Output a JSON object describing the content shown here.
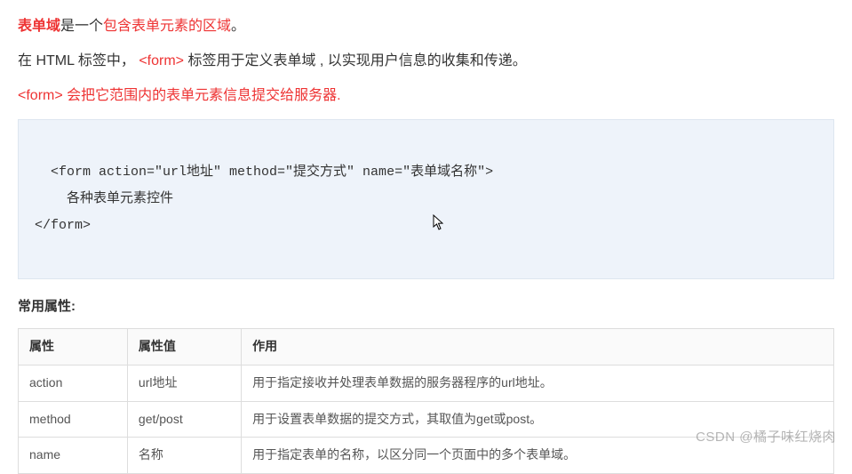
{
  "paragraphs": {
    "p1": {
      "s1": "表单域",
      "s2": "是一个",
      "s3": "包含表单元素的区域",
      "s4": "。"
    },
    "p2": {
      "s1": "在 HTML 标签中， ",
      "s2": "<form>",
      "s3": " 标签用于定义表单域 , 以实现用户信息的收集和传递。"
    },
    "p3": {
      "s1": "<form> 会把它范围内的表单元素信息提交给服务器."
    }
  },
  "code_block": "<form action=\"url地址\" method=\"提交方式\" name=\"表单域名称\">\n    各种表单元素控件\n</form>",
  "section_heading": "常用属性:",
  "table": {
    "headers": [
      "属性",
      "属性值",
      "作用"
    ],
    "rows": [
      {
        "attr": "action",
        "value": "url地址",
        "desc": "用于指定接收并处理表单数据的服务器程序的url地址。"
      },
      {
        "attr": "method",
        "value": "get/post",
        "desc": "用于设置表单数据的提交方式，其取值为get或post。"
      },
      {
        "attr": "name",
        "value": "名称",
        "desc": "用于指定表单的名称，以区分同一个页面中的多个表单域。"
      }
    ]
  },
  "watermark": "CSDN @橘子味红烧肉"
}
